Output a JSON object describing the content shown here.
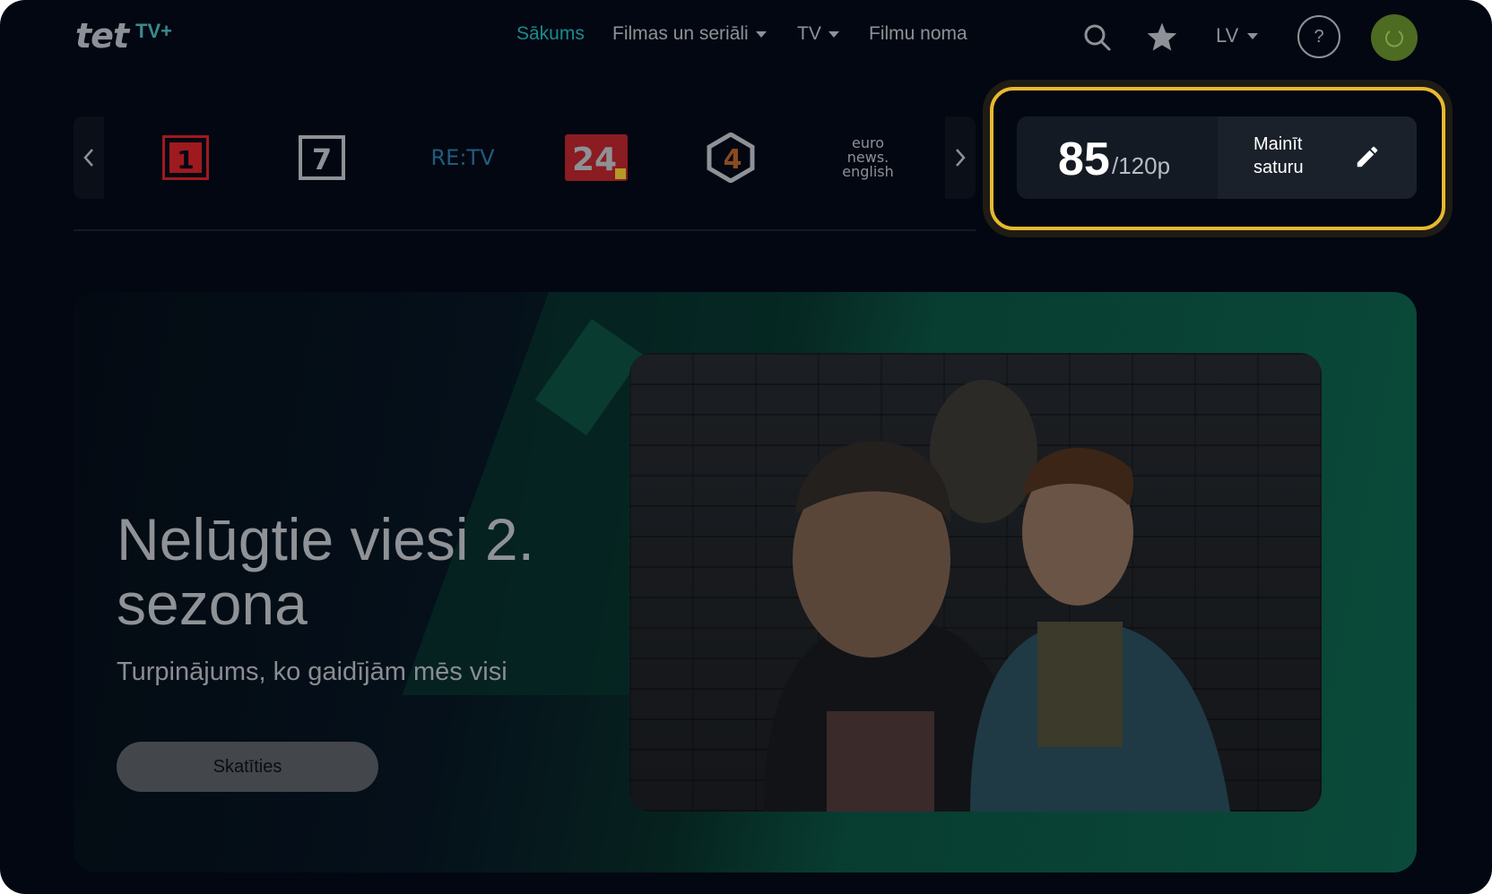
{
  "header": {
    "logo_text": "tet",
    "logo_badge": "TV+",
    "nav": [
      {
        "label": "Sākums",
        "active": true,
        "dropdown": false
      },
      {
        "label": "Filmas un seriāli",
        "active": false,
        "dropdown": true
      },
      {
        "label": "TV",
        "active": false,
        "dropdown": true
      },
      {
        "label": "Filmu noma",
        "active": false,
        "dropdown": false
      }
    ],
    "language": "LV",
    "help_label": "?",
    "icons": {
      "search": "search-icon",
      "favorites": "star-icon",
      "user": "power-icon"
    }
  },
  "channels": {
    "items": [
      {
        "name": "LTV1",
        "label": "1"
      },
      {
        "name": "LTV7",
        "label": "7"
      },
      {
        "name": "RE:TV",
        "label": "RE:TV"
      },
      {
        "name": "TV24",
        "label": "24"
      },
      {
        "name": "TV4",
        "label": "4"
      },
      {
        "name": "Euronews",
        "label": "euro news. english"
      }
    ]
  },
  "points": {
    "value": "85",
    "max": "/120p",
    "edit_label": "Mainīt saturu"
  },
  "hero": {
    "title": "Nelūgtie viesi 2. sezona",
    "subtitle": "Turpinājums, ko gaidījām mēs visi",
    "button_label": "Skatīties"
  },
  "colors": {
    "accent": "#1a8b8f",
    "highlight": "#e7b92f",
    "background": "#030711"
  }
}
